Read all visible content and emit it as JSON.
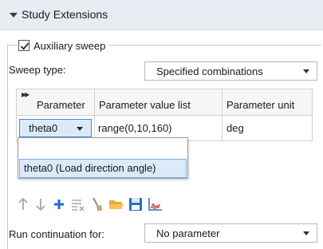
{
  "section": {
    "title": "Study Extensions"
  },
  "auxiliary": {
    "label": "Auxiliary sweep",
    "checked": true
  },
  "sweep_type": {
    "label": "Sweep type:",
    "value": "Specified combinations"
  },
  "table": {
    "headers": [
      "Parameter",
      "Parameter value list",
      "Parameter unit"
    ],
    "rows": [
      {
        "parameter": "theta0",
        "value_list": "range(0,10,160)",
        "unit": "deg"
      }
    ]
  },
  "parameter_dropdown": {
    "options": [
      "",
      "theta0 (Load direction angle)"
    ],
    "highlighted": "theta0 (Load direction angle)"
  },
  "toolbar": {
    "icons": [
      "move-up-icon",
      "move-down-icon",
      "add-icon",
      "delete-list-icon",
      "clear-icon",
      "open-folder-icon",
      "save-icon",
      "plot-icon"
    ],
    "colors": {
      "disabled": "#a8a8a8",
      "add": "#1f6fd1",
      "folder": "#f0a830",
      "save": "#2a6fc0",
      "plot": "#c03030"
    }
  },
  "continuation": {
    "label": "Run continuation for:",
    "value": "No parameter"
  }
}
